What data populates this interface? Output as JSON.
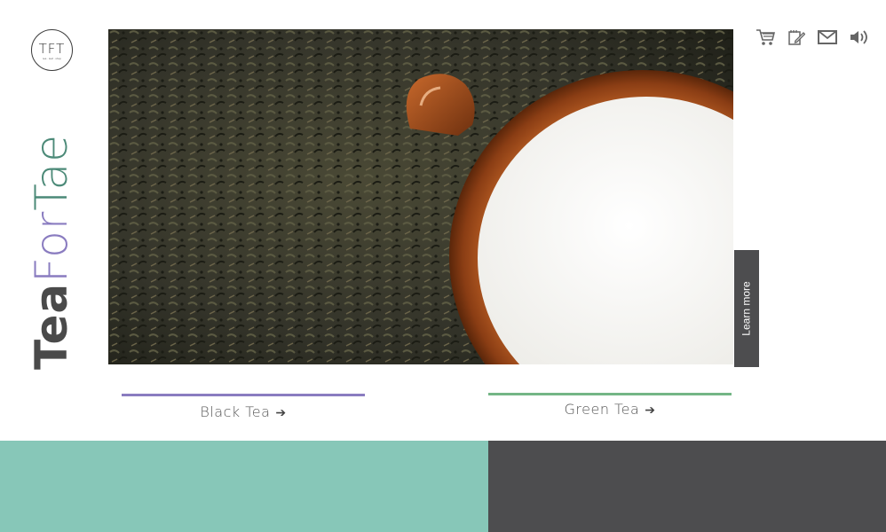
{
  "logo": {
    "text": "TFT",
    "subtext": "tea · leaf · shop"
  },
  "brand": {
    "part1": "Tea",
    "part2": "For",
    "part3": "Tae"
  },
  "hero": {
    "learn_more": "Learn more"
  },
  "header_icons": [
    "cart-icon",
    "edit-icon",
    "mail-icon",
    "speaker-icon"
  ],
  "tea_links": [
    {
      "label": "Black Tea",
      "arrow": "➔",
      "color": "#8a7cc0"
    },
    {
      "label": "Green Tea",
      "arrow": "➔",
      "color": "#74b686"
    }
  ],
  "colors": {
    "block_left": "#87c7b8",
    "block_right": "#4d4d4f",
    "purple": "#8a7cc0",
    "teal": "#4c8a78",
    "dark": "#4a4a4a"
  }
}
